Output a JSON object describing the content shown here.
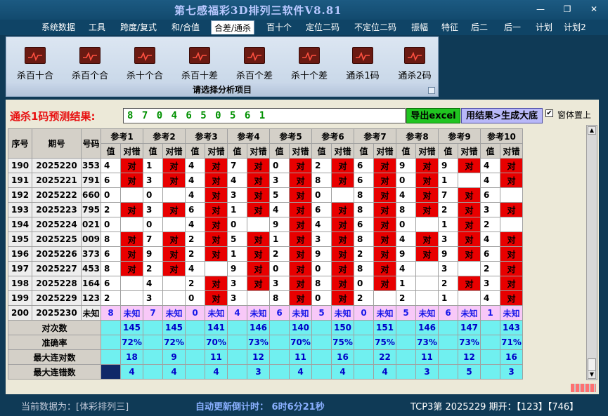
{
  "app": {
    "title": "第七感福彩3D排列三软件V8.81",
    "window_controls": [
      "—",
      "❐",
      "✕"
    ]
  },
  "menu": [
    "系统数据",
    "工具",
    "跨度/复式",
    "和/合值",
    "合差/通杀",
    "百十个",
    "定位二码",
    "不定位二码",
    "振幅",
    "特征",
    "后二",
    "后一",
    "计划",
    "计划2"
  ],
  "active_menu": "合差/通杀",
  "ribbon": {
    "caption": "请选择分析项目",
    "items": [
      "杀百十合",
      "杀百个合",
      "杀十个合",
      "杀百十差",
      "杀百个差",
      "杀十个差",
      "通杀1码",
      "通杀2码"
    ]
  },
  "prediction": {
    "label": "通杀1码预测结果:",
    "value": "8 7 0 4 6 5 0 5 6 1",
    "export_button": "导出excel",
    "apply_button": "用结果>生成大底",
    "topmost_label": "窗体置上",
    "topmost_checked": "✔"
  },
  "table": {
    "headers": {
      "seq": "序号",
      "issue": "期号",
      "number": "号码",
      "value": "值",
      "result": "对错"
    },
    "ref_groups": [
      "参考1",
      "参考2",
      "参考3",
      "参考4",
      "参考5",
      "参考6",
      "参考7",
      "参考8",
      "参考9",
      "参考10"
    ],
    "hit_mark": "对",
    "rows": [
      {
        "seq": "190",
        "issue": "2025220",
        "number": "353",
        "vals": [
          "4",
          "1",
          "4",
          "7",
          "0",
          "2",
          "6",
          "9",
          "9",
          "4"
        ],
        "hits": [
          1,
          1,
          1,
          1,
          1,
          1,
          1,
          1,
          1,
          1
        ]
      },
      {
        "seq": "191",
        "issue": "2025221",
        "number": "791",
        "vals": [
          "6",
          "3",
          "4",
          "4",
          "3",
          "8",
          "6",
          "0",
          "1",
          "4"
        ],
        "hits": [
          1,
          1,
          1,
          1,
          1,
          1,
          1,
          1,
          0,
          1
        ]
      },
      {
        "seq": "192",
        "issue": "2025222",
        "number": "660",
        "vals": [
          "0",
          "0",
          "4",
          "3",
          "5",
          "0",
          "8",
          "4",
          "7",
          "6"
        ],
        "hits": [
          0,
          0,
          1,
          1,
          1,
          0,
          1,
          1,
          1,
          0
        ]
      },
      {
        "seq": "193",
        "issue": "2025223",
        "number": "795",
        "vals": [
          "2",
          "3",
          "6",
          "1",
          "4",
          "6",
          "8",
          "8",
          "2",
          "3"
        ],
        "hits": [
          1,
          1,
          1,
          1,
          1,
          1,
          1,
          1,
          1,
          1
        ]
      },
      {
        "seq": "194",
        "issue": "2025224",
        "number": "021",
        "vals": [
          "0",
          "0",
          "4",
          "0",
          "9",
          "4",
          "6",
          "0",
          "1",
          "2"
        ],
        "hits": [
          0,
          0,
          1,
          0,
          1,
          1,
          1,
          0,
          1,
          0
        ]
      },
      {
        "seq": "195",
        "issue": "2025225",
        "number": "009",
        "vals": [
          "8",
          "7",
          "2",
          "5",
          "1",
          "3",
          "8",
          "4",
          "3",
          "4"
        ],
        "hits": [
          1,
          1,
          1,
          1,
          1,
          1,
          1,
          1,
          1,
          1
        ]
      },
      {
        "seq": "196",
        "issue": "2025226",
        "number": "373",
        "vals": [
          "6",
          "9",
          "2",
          "1",
          "2",
          "9",
          "2",
          "9",
          "9",
          "6"
        ],
        "hits": [
          1,
          1,
          1,
          1,
          1,
          1,
          1,
          1,
          1,
          1
        ]
      },
      {
        "seq": "197",
        "issue": "2025227",
        "number": "453",
        "vals": [
          "8",
          "2",
          "4",
          "9",
          "0",
          "0",
          "8",
          "4",
          "3",
          "2"
        ],
        "hits": [
          1,
          1,
          0,
          1,
          1,
          1,
          1,
          0,
          0,
          1
        ]
      },
      {
        "seq": "198",
        "issue": "2025228",
        "number": "164",
        "vals": [
          "6",
          "4",
          "2",
          "3",
          "3",
          "8",
          "0",
          "1",
          "2",
          "3"
        ],
        "hits": [
          0,
          0,
          1,
          1,
          1,
          1,
          1,
          0,
          1,
          1
        ]
      },
      {
        "seq": "199",
        "issue": "2025229",
        "number": "123",
        "vals": [
          "2",
          "3",
          "0",
          "3",
          "8",
          "0",
          "2",
          "2",
          "1",
          "4"
        ],
        "hits": [
          0,
          0,
          1,
          0,
          1,
          1,
          0,
          0,
          0,
          1
        ]
      },
      {
        "seq": "200",
        "issue": "2025230",
        "number": "未知",
        "vals": [
          "8",
          "7",
          "0",
          "4",
          "6",
          "5",
          "0",
          "5",
          "6",
          "1"
        ],
        "pred": "未知"
      }
    ],
    "stats": [
      {
        "label": "对次数",
        "vals": [
          "145",
          "145",
          "141",
          "146",
          "140",
          "150",
          "151",
          "146",
          "147",
          "143"
        ]
      },
      {
        "label": "准确率",
        "vals": [
          "72%",
          "72%",
          "70%",
          "73%",
          "70%",
          "75%",
          "75%",
          "73%",
          "73%",
          "71%"
        ]
      },
      {
        "label": "最大连对数",
        "vals": [
          "18",
          "9",
          "11",
          "12",
          "11",
          "16",
          "22",
          "11",
          "12",
          "16"
        ]
      },
      {
        "label": "最大连错数",
        "vals": [
          "4",
          "4",
          "4",
          "3",
          "4",
          "4",
          "4",
          "3",
          "5",
          "3"
        ]
      }
    ]
  },
  "status": {
    "source": "当前数据为：[体彩排列三]",
    "countdown": "自动更新倒计时： 6时6分21秒",
    "issue": "TCP3第 2025229 期开：【123】【746】"
  },
  "colors": {
    "hit": "#e80000",
    "stats_bg": "#70f0f0",
    "pred_bg": "#f8c8f8",
    "frame": "#0f3a56"
  }
}
